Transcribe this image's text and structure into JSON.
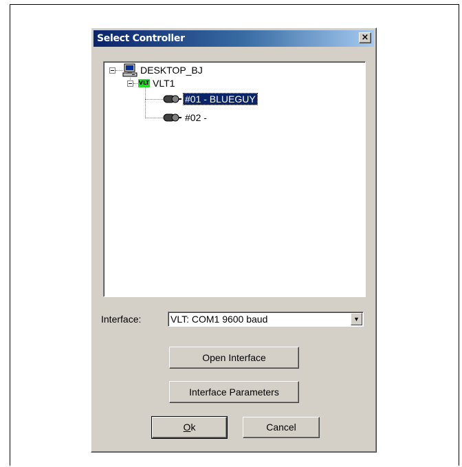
{
  "window": {
    "title": "Select Controller",
    "close_glyph": "×"
  },
  "tree": {
    "root": {
      "label": "DESKTOP_BJ",
      "icon": "computer-icon"
    },
    "group": {
      "label": "VLT1",
      "icon_text": "VLT"
    },
    "items": [
      {
        "label": "#01 - BLUEGUY",
        "selected": true,
        "icon": "controller-icon"
      },
      {
        "label": "#02 -",
        "selected": false,
        "icon": "controller-icon"
      }
    ]
  },
  "interface": {
    "label": "Interface:",
    "value": "VLT:  COM1  9600 baud",
    "arrow": "▼"
  },
  "buttons": {
    "open_interface": "Open Interface",
    "interface_parameters": "Interface Parameters",
    "ok_mnemonic": "O",
    "ok_rest": "k",
    "cancel": "Cancel"
  },
  "colors": {
    "title_start": "#0a246a",
    "title_end": "#a6caf0",
    "selection": "#0a246a",
    "vlt_badge": "#22dd22",
    "face": "#d4d0c8"
  }
}
